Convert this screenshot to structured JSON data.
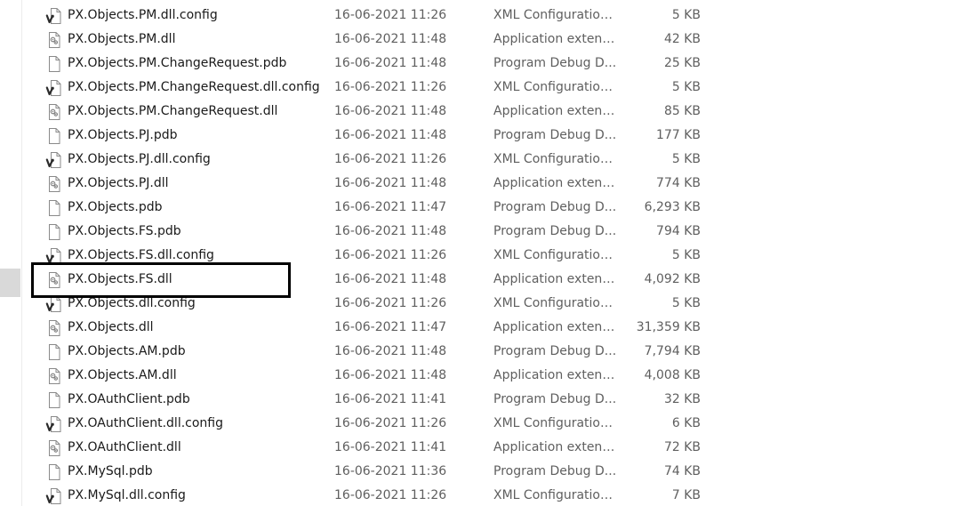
{
  "colors": {
    "name_text": "#1a1a1a",
    "meta_text": "#5f5f5f",
    "highlight_border": "#000000",
    "gutter_mark": "#d9d9d9"
  },
  "files": [
    {
      "name": "PX.Objects.PM.dll.config",
      "date": "16-06-2021 11:26",
      "type": "XML Configuration...",
      "size": "5 KB",
      "icon": "config-file-icon"
    },
    {
      "name": "PX.Objects.PM.dll",
      "date": "16-06-2021 11:48",
      "type": "Application extens...",
      "size": "42 KB",
      "icon": "dll-file-icon"
    },
    {
      "name": "PX.Objects.PM.ChangeRequest.pdb",
      "date": "16-06-2021 11:48",
      "type": "Program Debug D...",
      "size": "25 KB",
      "icon": "blank-file-icon"
    },
    {
      "name": "PX.Objects.PM.ChangeRequest.dll.config",
      "date": "16-06-2021 11:26",
      "type": "XML Configuration...",
      "size": "5 KB",
      "icon": "config-file-icon"
    },
    {
      "name": "PX.Objects.PM.ChangeRequest.dll",
      "date": "16-06-2021 11:48",
      "type": "Application extens...",
      "size": "85 KB",
      "icon": "dll-file-icon"
    },
    {
      "name": "PX.Objects.PJ.pdb",
      "date": "16-06-2021 11:48",
      "type": "Program Debug D...",
      "size": "177 KB",
      "icon": "blank-file-icon"
    },
    {
      "name": "PX.Objects.PJ.dll.config",
      "date": "16-06-2021 11:26",
      "type": "XML Configuration...",
      "size": "5 KB",
      "icon": "config-file-icon"
    },
    {
      "name": "PX.Objects.PJ.dll",
      "date": "16-06-2021 11:48",
      "type": "Application extens...",
      "size": "774 KB",
      "icon": "dll-file-icon"
    },
    {
      "name": "PX.Objects.pdb",
      "date": "16-06-2021 11:47",
      "type": "Program Debug D...",
      "size": "6,293 KB",
      "icon": "blank-file-icon"
    },
    {
      "name": "PX.Objects.FS.pdb",
      "date": "16-06-2021 11:48",
      "type": "Program Debug D...",
      "size": "794 KB",
      "icon": "blank-file-icon"
    },
    {
      "name": "PX.Objects.FS.dll.config",
      "date": "16-06-2021 11:26",
      "type": "XML Configuration...",
      "size": "5 KB",
      "icon": "config-file-icon"
    },
    {
      "name": "PX.Objects.FS.dll",
      "date": "16-06-2021 11:48",
      "type": "Application extens...",
      "size": "4,092 KB",
      "icon": "dll-file-icon"
    },
    {
      "name": "PX.Objects.dll.config",
      "date": "16-06-2021 11:26",
      "type": "XML Configuration...",
      "size": "5 KB",
      "icon": "config-file-icon"
    },
    {
      "name": "PX.Objects.dll",
      "date": "16-06-2021 11:47",
      "type": "Application extens...",
      "size": "31,359 KB",
      "icon": "dll-file-icon"
    },
    {
      "name": "PX.Objects.AM.pdb",
      "date": "16-06-2021 11:48",
      "type": "Program Debug D...",
      "size": "7,794 KB",
      "icon": "blank-file-icon"
    },
    {
      "name": "PX.Objects.AM.dll",
      "date": "16-06-2021 11:48",
      "type": "Application extens...",
      "size": "4,008 KB",
      "icon": "dll-file-icon"
    },
    {
      "name": "PX.OAuthClient.pdb",
      "date": "16-06-2021 11:41",
      "type": "Program Debug D...",
      "size": "32 KB",
      "icon": "blank-file-icon"
    },
    {
      "name": "PX.OAuthClient.dll.config",
      "date": "16-06-2021 11:26",
      "type": "XML Configuration...",
      "size": "6 KB",
      "icon": "config-file-icon"
    },
    {
      "name": "PX.OAuthClient.dll",
      "date": "16-06-2021 11:41",
      "type": "Application extens...",
      "size": "72 KB",
      "icon": "dll-file-icon"
    },
    {
      "name": "PX.MySql.pdb",
      "date": "16-06-2021 11:36",
      "type": "Program Debug D...",
      "size": "74 KB",
      "icon": "blank-file-icon"
    },
    {
      "name": "PX.MySql.dll.config",
      "date": "16-06-2021 11:26",
      "type": "XML Configuration...",
      "size": "7 KB",
      "icon": "config-file-icon"
    }
  ]
}
